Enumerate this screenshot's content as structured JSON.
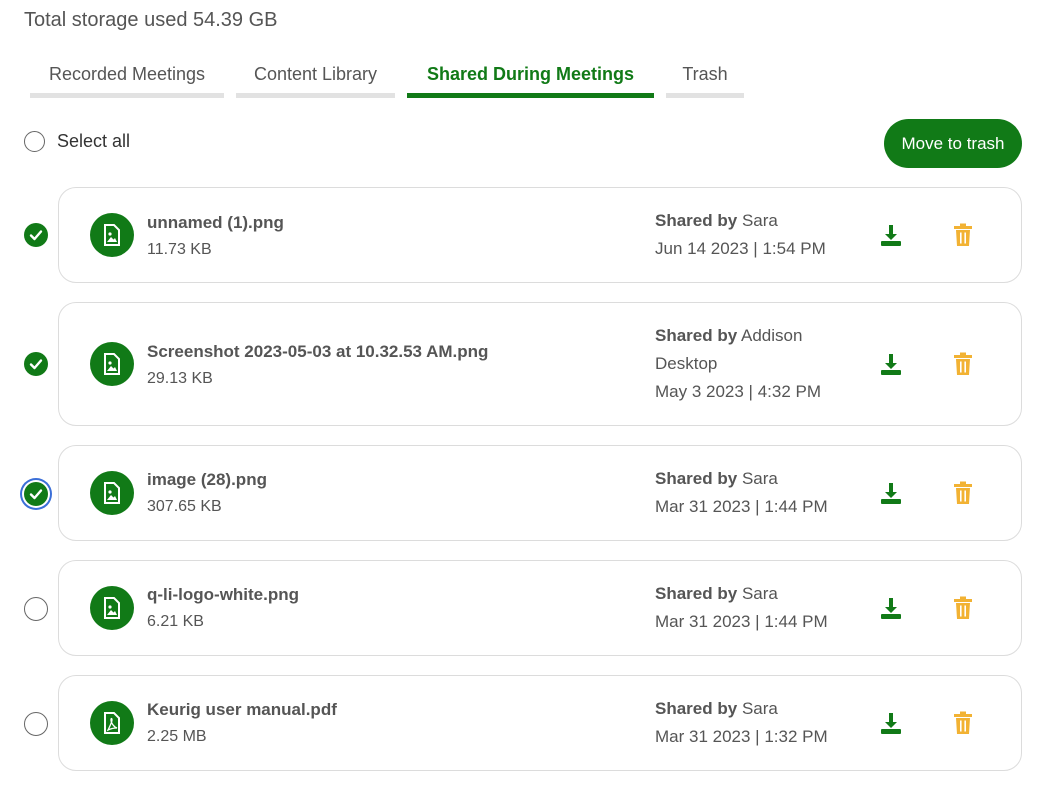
{
  "storage": {
    "label": "Total storage used 54.39 GB"
  },
  "tabs": [
    {
      "label": "Recorded Meetings",
      "active": false
    },
    {
      "label": "Content Library",
      "active": false
    },
    {
      "label": "Shared During Meetings",
      "active": true
    },
    {
      "label": "Trash",
      "active": false
    }
  ],
  "select_all": {
    "label": "Select all",
    "checked": false
  },
  "move_to_trash": {
    "label": "Move to trash"
  },
  "colors": {
    "accent": "#117a17",
    "trash": "#f2b233",
    "border": "#dcdcdc"
  },
  "files": [
    {
      "name": "unnamed (1).png",
      "size": "11.73 KB",
      "shared_by_label": "Shared by",
      "shared_by": "Sara",
      "shared_by_extra": "",
      "date": "Jun 14 2023 | 1:54 PM",
      "checked": true,
      "icon": "image-file-icon"
    },
    {
      "name": "Screenshot 2023-05-03 at 10.32.53 AM.png",
      "size": "29.13 KB",
      "shared_by_label": "Shared by",
      "shared_by": "Addison",
      "shared_by_extra": "Desktop",
      "date": "May 3 2023 | 4:32 PM",
      "checked": true,
      "icon": "image-file-icon"
    },
    {
      "name": "image (28).png",
      "size": "307.65 KB",
      "shared_by_label": "Shared by",
      "shared_by": "Sara",
      "shared_by_extra": "",
      "date": "Mar 31 2023 | 1:44 PM",
      "checked": true,
      "icon": "image-file-icon"
    },
    {
      "name": "q-li-logo-white.png",
      "size": "6.21 KB",
      "shared_by_label": "Shared by",
      "shared_by": "Sara",
      "shared_by_extra": "",
      "date": "Mar 31 2023 | 1:44 PM",
      "checked": false,
      "icon": "image-file-icon"
    },
    {
      "name": "Keurig user manual.pdf",
      "size": "2.25 MB",
      "shared_by_label": "Shared by",
      "shared_by": "Sara",
      "shared_by_extra": "",
      "date": "Mar 31 2023 | 1:32 PM",
      "checked": false,
      "icon": "pdf-file-icon"
    }
  ]
}
